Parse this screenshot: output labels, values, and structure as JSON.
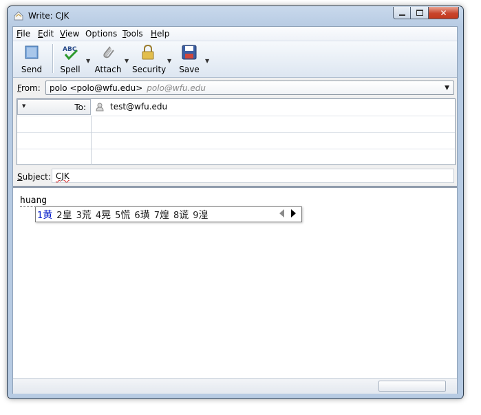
{
  "window": {
    "title": "Write: CJK"
  },
  "menu": [
    {
      "label": "File"
    },
    {
      "label": "Edit"
    },
    {
      "label": "View"
    },
    {
      "label": "Options"
    },
    {
      "label": "Tools"
    },
    {
      "label": "Help"
    }
  ],
  "toolbar": {
    "send_label": "Send",
    "spell_label": "Spell",
    "attach_label": "Attach",
    "security_label": "Security",
    "save_label": "Save",
    "icons": [
      "send-icon",
      "spell-check-icon",
      "paperclip-icon",
      "lock-icon",
      "floppy-disk-icon"
    ]
  },
  "from": {
    "label": "From:",
    "value": "polo <polo@wfu.edu>",
    "ghost": "polo@wfu.edu"
  },
  "recipients": {
    "type_label": "To:",
    "address": "test@wfu.edu"
  },
  "subject": {
    "label": "Subject:",
    "value": "CJK"
  },
  "compose": {
    "text": "huang"
  },
  "ime": {
    "candidates": [
      {
        "num": "1",
        "char": "黄"
      },
      {
        "num": "2",
        "char": "皇"
      },
      {
        "num": "3",
        "char": "荒"
      },
      {
        "num": "4",
        "char": "晃"
      },
      {
        "num": "5",
        "char": "慌"
      },
      {
        "num": "6",
        "char": "璜"
      },
      {
        "num": "7",
        "char": "煌"
      },
      {
        "num": "8",
        "char": "谎"
      },
      {
        "num": "9",
        "char": "湟"
      }
    ],
    "selected_index": 0,
    "selected_color": "#0019c8"
  },
  "colors": {
    "window_frame": "#b7cbe3",
    "close_button": "#c8452c"
  }
}
